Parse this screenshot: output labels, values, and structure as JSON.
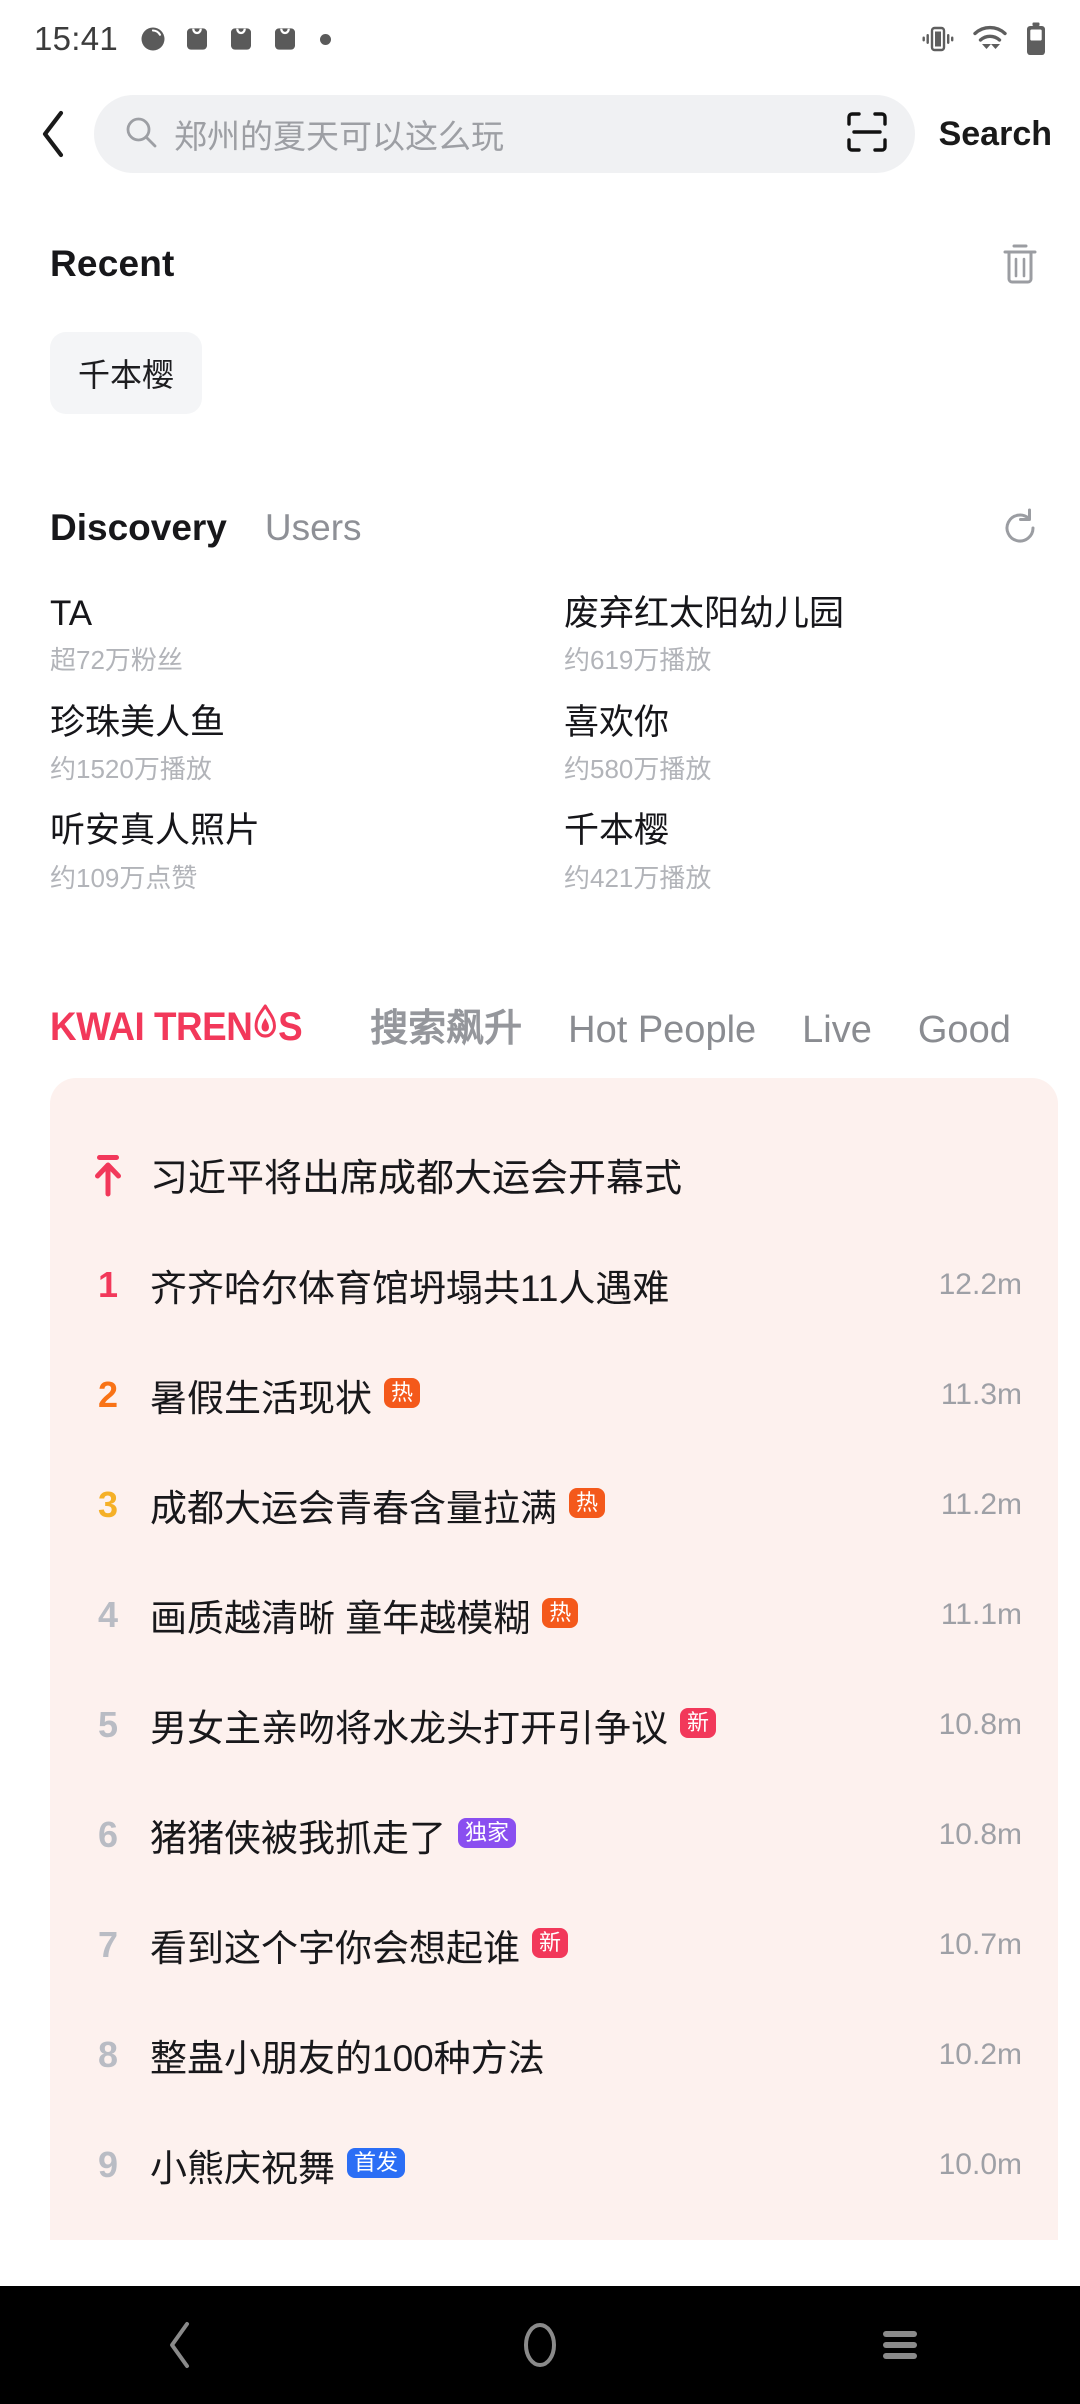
{
  "status_bar": {
    "time": "15:41",
    "left_icons": [
      "clock-icon",
      "app-icon",
      "app-icon",
      "app-icon",
      "dot-indicator"
    ],
    "right_icons": [
      "vibrate-icon",
      "wifi-icon",
      "battery-icon"
    ]
  },
  "header": {
    "back_label": "back-arrow",
    "search_placeholder": "郑州的夏天可以这么玩",
    "scan_label": "scan-code",
    "search_button": "Search"
  },
  "recent": {
    "title": "Recent",
    "clear_label": "clear-history",
    "chips": [
      "千本樱"
    ]
  },
  "discovery": {
    "tabs": [
      {
        "label": "Discovery",
        "active": true
      },
      {
        "label": "Users",
        "active": false
      }
    ],
    "refresh_label": "refresh",
    "items": [
      {
        "name": "TA",
        "meta": "超72万粉丝"
      },
      {
        "name": "废弃红太阳幼儿园",
        "meta": "约619万播放"
      },
      {
        "name": "珍珠美人鱼",
        "meta": "约1520万播放"
      },
      {
        "name": "喜欢你",
        "meta": "约580万播放"
      },
      {
        "name": "听安真人照片",
        "meta": "约109万点赞"
      },
      {
        "name": "千本樱",
        "meta": "约421万播放"
      }
    ]
  },
  "trends": {
    "logo_pre": "KWAI TREN",
    "logo_post": "S",
    "tabs": [
      {
        "label": "搜索飙升",
        "cjk": true
      },
      {
        "label": "Hot People",
        "cjk": false
      },
      {
        "label": "Live",
        "cjk": false
      },
      {
        "label": "Good",
        "cjk": false
      }
    ],
    "colors": {
      "brand": "#f2385a",
      "card_bg": "#fdf1ee",
      "rank1": "#f2385a",
      "rank2": "#f97316",
      "rank3": "#f5b027",
      "rank_default": "#b9bcc4",
      "badge_hot": "#f4591b",
      "badge_new": "#f2385a",
      "badge_exclusive": "#8a4ff0",
      "badge_debut": "#2b6ef5"
    },
    "rows": [
      {
        "rank": "",
        "pinned": true,
        "title": "习近平将出席成都大运会开幕式",
        "badge": "",
        "badge_type": "",
        "count": ""
      },
      {
        "rank": "1",
        "pinned": false,
        "title": "齐齐哈尔体育馆坍塌共11人遇难",
        "badge": "",
        "badge_type": "",
        "count": "12.2m"
      },
      {
        "rank": "2",
        "pinned": false,
        "title": "暑假生活现状",
        "badge": "热",
        "badge_type": "hot",
        "count": "11.3m"
      },
      {
        "rank": "3",
        "pinned": false,
        "title": "成都大运会青春含量拉满",
        "badge": "热",
        "badge_type": "hot",
        "count": "11.2m"
      },
      {
        "rank": "4",
        "pinned": false,
        "title": "画质越清晰 童年越模糊",
        "badge": "热",
        "badge_type": "hot",
        "count": "11.1m"
      },
      {
        "rank": "5",
        "pinned": false,
        "title": "男女主亲吻将水龙头打开引争议",
        "badge": "新",
        "badge_type": "new",
        "count": "10.8m"
      },
      {
        "rank": "6",
        "pinned": false,
        "title": "猪猪侠被我抓走了",
        "badge": "独家",
        "badge_type": "exclusive",
        "count": "10.8m"
      },
      {
        "rank": "7",
        "pinned": false,
        "title": "看到这个字你会想起谁",
        "badge": "新",
        "badge_type": "new",
        "count": "10.7m"
      },
      {
        "rank": "8",
        "pinned": false,
        "title": "整蛊小朋友的100种方法",
        "badge": "",
        "badge_type": "",
        "count": "10.2m"
      },
      {
        "rank": "9",
        "pinned": false,
        "title": "小熊庆祝舞",
        "badge": "首发",
        "badge_type": "debut",
        "count": "10.0m"
      }
    ]
  },
  "navbar": {
    "buttons": [
      "back-nav",
      "home-nav",
      "recents-nav"
    ]
  }
}
